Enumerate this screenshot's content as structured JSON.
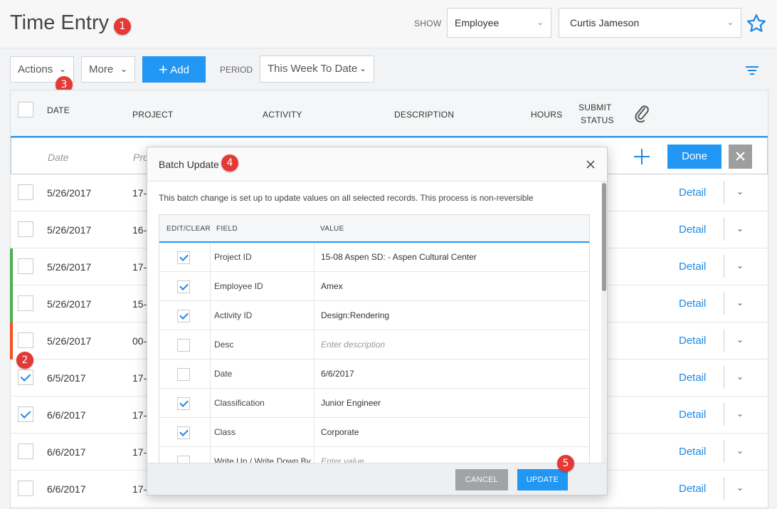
{
  "header": {
    "title": "Time Entry",
    "show_label": "SHOW",
    "show_type": "Employee",
    "show_person": "Curtis Jameson"
  },
  "toolbar": {
    "actions_label": "Actions",
    "more_label": "More",
    "add_label": "Add",
    "period_label": "PERIOD",
    "period_value": "This Week To Date"
  },
  "grid": {
    "columns": {
      "date": "DATE",
      "project": "PROJECT",
      "activity": "ACTIVITY",
      "description": "DESCRIPTION",
      "hours": "HOURS",
      "submit_status_1": "SUBMIT",
      "submit_status_2": "STATUS"
    },
    "new_row": {
      "date_placeholder": "Date",
      "project_placeholder": "Pro",
      "done_label": "Done"
    },
    "detail_label": "Detail",
    "rows": [
      {
        "date": "5/26/2017",
        "project": "17-",
        "checked": false,
        "stripe": ""
      },
      {
        "date": "5/26/2017",
        "project": "16-",
        "checked": false,
        "stripe": ""
      },
      {
        "date": "5/26/2017",
        "project": "17-",
        "checked": false,
        "stripe": "#4caf50"
      },
      {
        "date": "5/26/2017",
        "project": "15-",
        "checked": false,
        "stripe": "#4caf50"
      },
      {
        "date": "5/26/2017",
        "project": "00-",
        "checked": false,
        "stripe": "#f4511e"
      },
      {
        "date": "6/5/2017",
        "project": "17-",
        "checked": true,
        "stripe": ""
      },
      {
        "date": "6/6/2017",
        "project": "17-",
        "checked": true,
        "stripe": ""
      },
      {
        "date": "6/6/2017",
        "project": "17-",
        "checked": false,
        "stripe": ""
      },
      {
        "date": "6/6/2017",
        "project": "17-",
        "checked": false,
        "stripe": ""
      }
    ]
  },
  "modal": {
    "title": "Batch Update",
    "notice": "This batch change is set up to update values on all selected records. This process is non-reversible",
    "columns": {
      "edit_clear": "EDIT/CLEAR",
      "field": "FIELD",
      "value": "VALUE"
    },
    "rows": [
      {
        "field": "Project ID",
        "value": "15-08 Aspen SD: - Aspen Cultural Center",
        "checked": true,
        "placeholder": false
      },
      {
        "field": "Employee ID",
        "value": "Amex",
        "checked": true,
        "placeholder": false
      },
      {
        "field": "Activity ID",
        "value": "Design:Rendering",
        "checked": true,
        "placeholder": false
      },
      {
        "field": "Desc",
        "value": "Enter description",
        "checked": false,
        "placeholder": true
      },
      {
        "field": "Date",
        "value": "6/6/2017",
        "checked": false,
        "placeholder": false
      },
      {
        "field": "Classification",
        "value": "Junior Engineer",
        "checked": true,
        "placeholder": false
      },
      {
        "field": "Class",
        "value": "Corporate",
        "checked": true,
        "placeholder": false
      },
      {
        "field": "Write Up / Write Down By",
        "value": "Enter value",
        "checked": false,
        "placeholder": true
      }
    ],
    "cancel_label": "CANCEL",
    "update_label": "UPDATE"
  },
  "badges": [
    "1",
    "2",
    "3",
    "4",
    "5"
  ],
  "colors": {
    "accent": "#2196f3",
    "badge": "#e53935",
    "link": "#1e88e5"
  }
}
